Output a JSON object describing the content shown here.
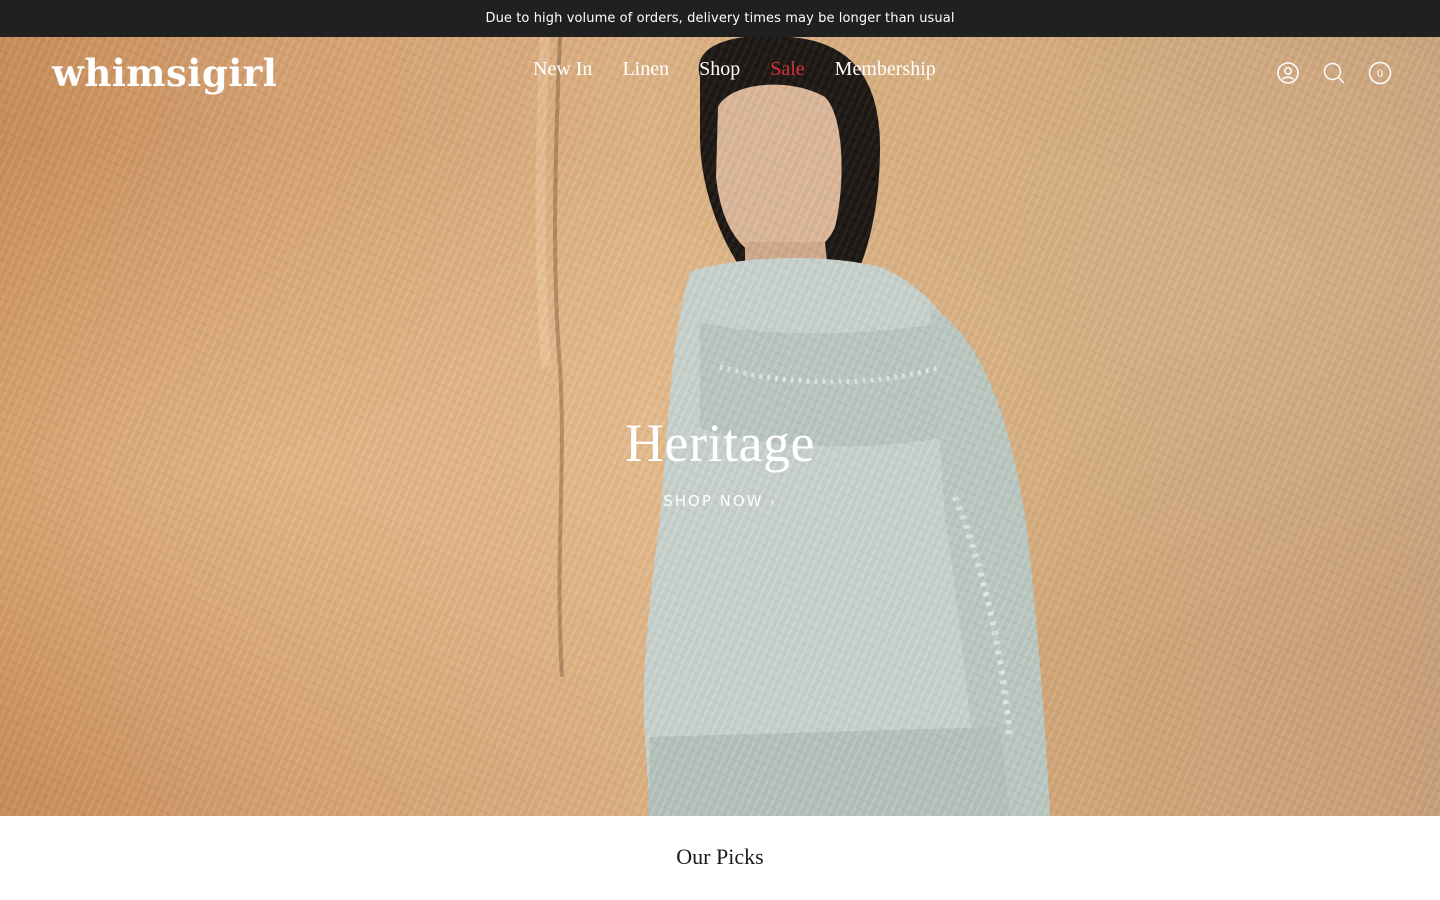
{
  "announcement": {
    "text": "Due to high volume of orders, delivery times may be longer than usual"
  },
  "header": {
    "logo": "whimsigirl",
    "nav": [
      {
        "label": "New In"
      },
      {
        "label": "Linen"
      },
      {
        "label": "Shop"
      },
      {
        "label": "Sale",
        "color": "#d3333a"
      },
      {
        "label": "Membership"
      }
    ],
    "icons": {
      "account": "account-icon",
      "search": "search-icon",
      "cart": "cart-icon"
    },
    "cart_count": "0"
  },
  "hero": {
    "title": "Heritage",
    "cta": "SHOP NOW"
  },
  "picks": {
    "title": "Our Picks"
  },
  "colors": {
    "announcement_bg": "#202020",
    "sale": "#d3333a",
    "hero_bg": "#d6a171",
    "garment": "#c9d2cd"
  }
}
